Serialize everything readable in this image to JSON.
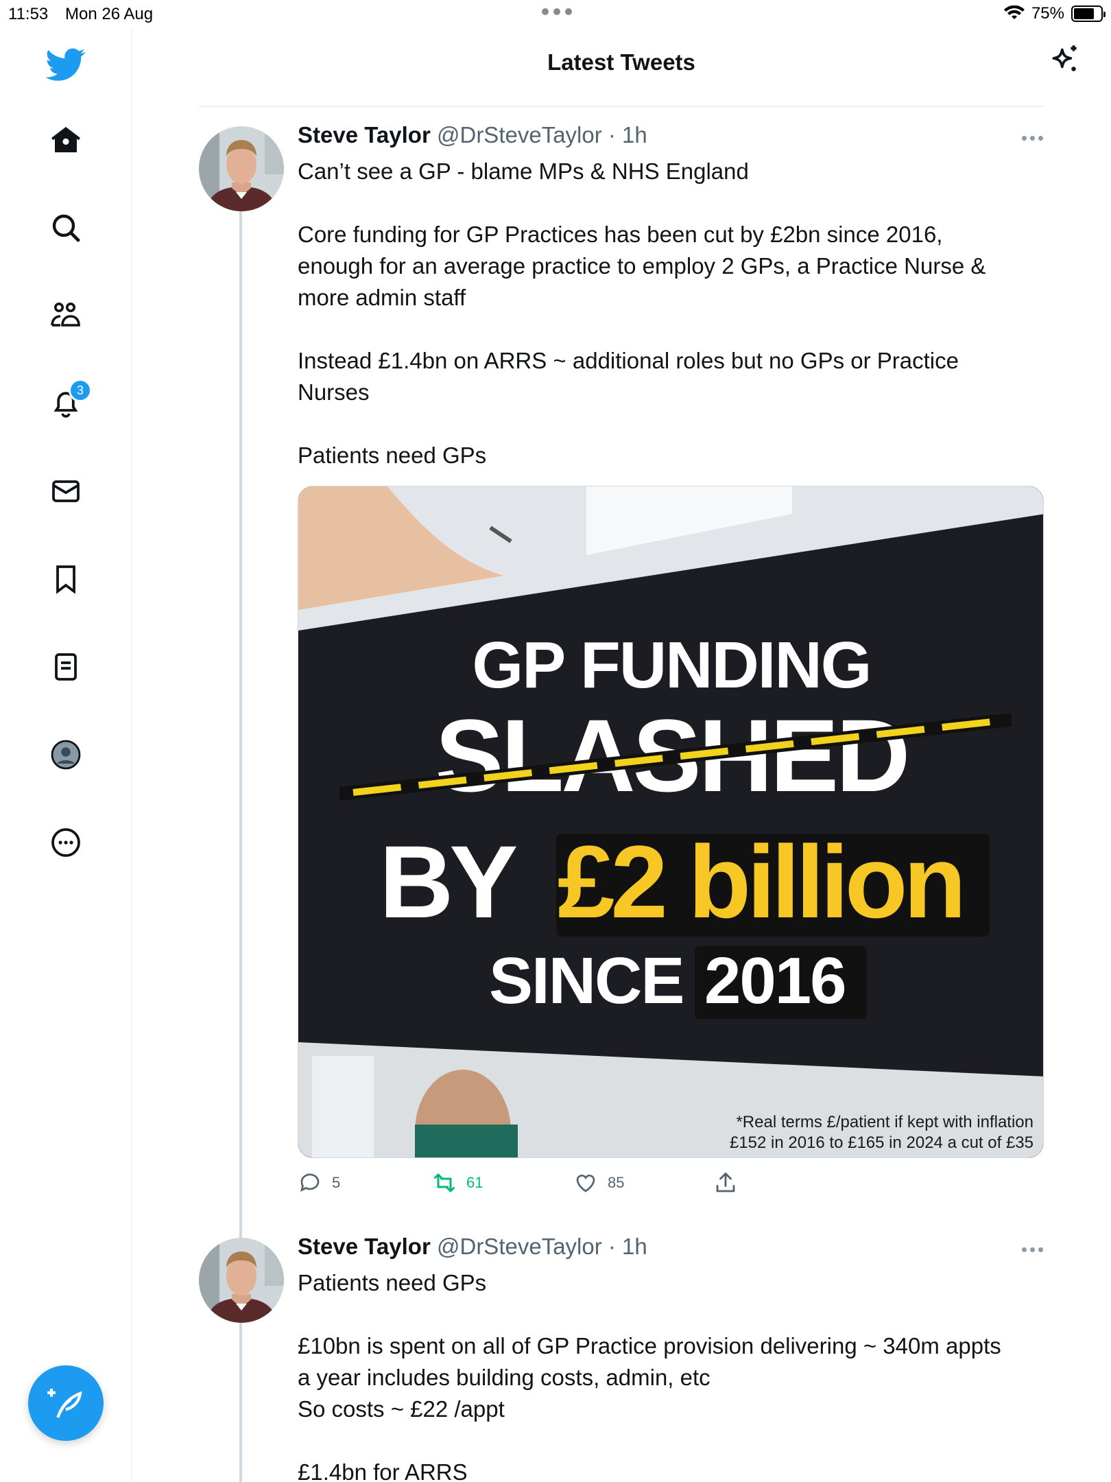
{
  "status_bar": {
    "time": "11:53",
    "date": "Mon 26 Aug",
    "battery_text": "75%",
    "battery_level": 0.75
  },
  "sidebar": {
    "items": [
      {
        "icon": "twitter-bird-icon"
      },
      {
        "icon": "home-icon"
      },
      {
        "icon": "search-icon"
      },
      {
        "icon": "communities-icon"
      },
      {
        "icon": "notifications-bell-icon",
        "badge": "3"
      },
      {
        "icon": "messages-icon"
      },
      {
        "icon": "bookmarks-icon"
      },
      {
        "icon": "lists-icon"
      },
      {
        "icon": "profile-icon"
      },
      {
        "icon": "more-options-icon"
      }
    ],
    "compose_icon": "compose-feather-icon"
  },
  "header": {
    "title": "Latest Tweets",
    "right_icon": "sparkle-icon"
  },
  "tweets": [
    {
      "name": "Steve Taylor",
      "handle": "@DrSteveTaylor",
      "time": "· 1h",
      "text": [
        "Can’t see a GP - blame MPs & NHS England",
        "",
        "Core funding for GP Practices has been cut by £2bn since 2016,",
        "enough for an average practice to employ 2 GPs, a Practice Nurse &",
        "more admin staff",
        "",
        "Instead £1.4bn on ARRS ~ additional roles but no GPs or Practice",
        "Nurses",
        "",
        "Patients need GPs"
      ],
      "media": {
        "line1": "GP FUNDING",
        "line2": "SLASHED",
        "line3a": "BY",
        "line3b": "£2 billion",
        "line4a": "SINCE",
        "line4b": "2016",
        "footnote_1": "*Real terms £/patient if kept with inflation",
        "footnote_2": "£152 in 2016 to £165 in 2024 a cut of £35"
      },
      "actions": {
        "replies": "5",
        "retweets": "61",
        "likes": "85"
      }
    },
    {
      "name": "Steve Taylor",
      "handle": "@DrSteveTaylor",
      "time": "· 1h",
      "text": [
        "Patients need GPs",
        "",
        "£10bn is spent on all of GP Practice provision delivering ~ 340m appts",
        "a year includes building costs, admin, etc",
        "So costs ~ £22 /appt",
        "",
        "£1.4bn for ARRS"
      ]
    }
  ],
  "colors": {
    "accent": "#1d9bf0",
    "retweet_green": "#00ba7c",
    "highlight_yellow": "#f6c725",
    "muted_text": "#536471"
  }
}
